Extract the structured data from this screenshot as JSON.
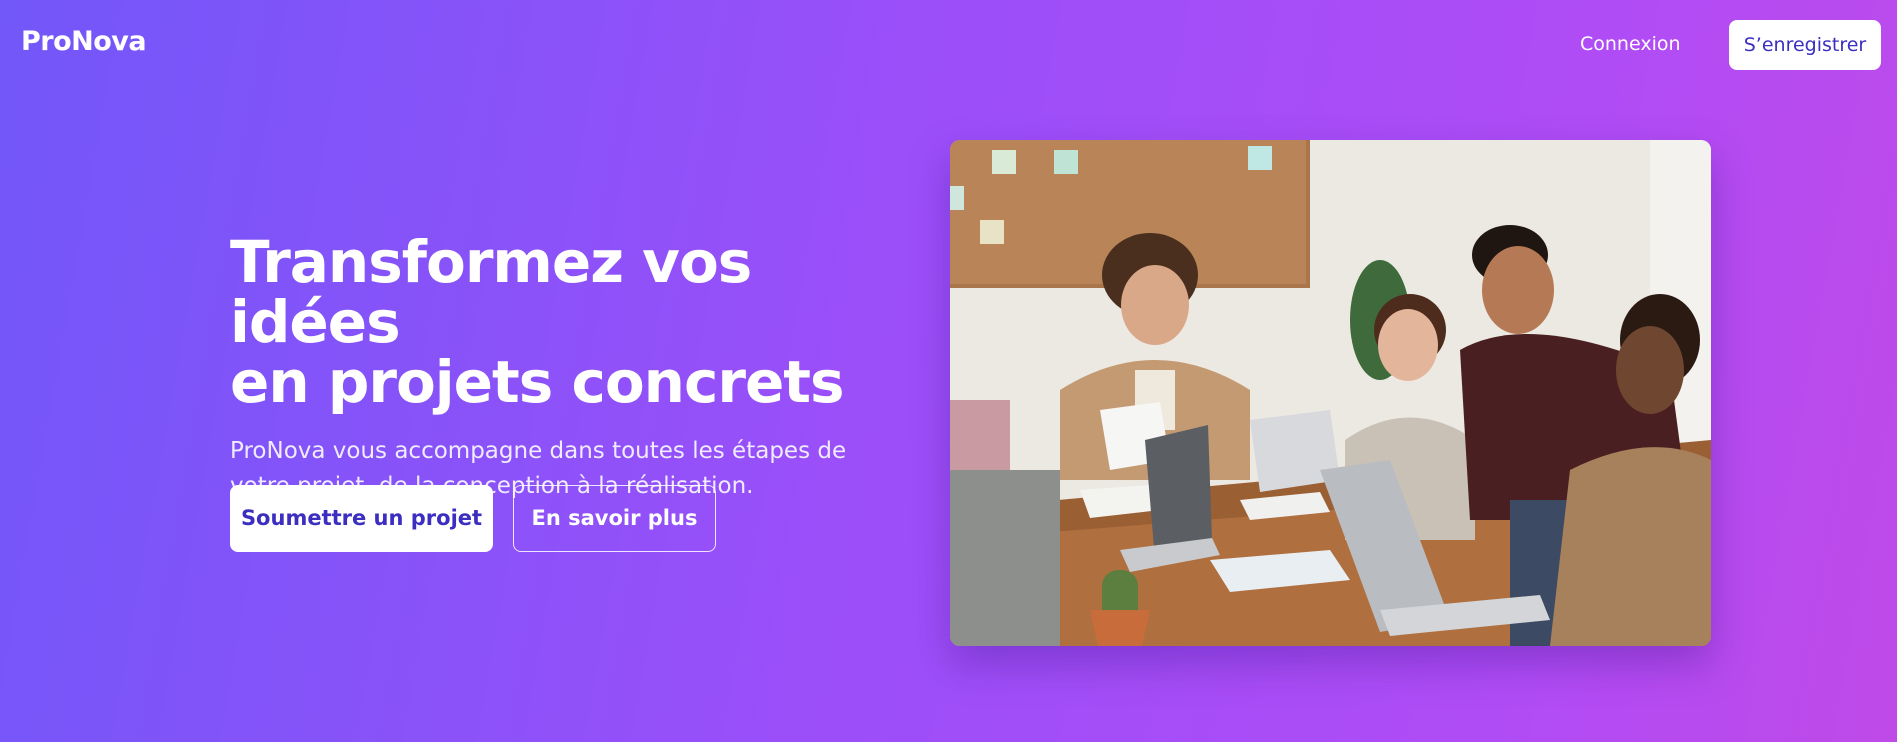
{
  "header": {
    "logo": "ProNova",
    "login_label": "Connexion",
    "register_label": "S’enregistrer"
  },
  "hero": {
    "title_line1": "Transformez vos idées",
    "title_line2": "en projets concrets",
    "subtitle": "ProNova vous accompagne dans toutes les étapes de votre projet, de la conception à la réalisation.",
    "primary_button": "Soumettre un projet",
    "secondary_button": "En savoir plus"
  },
  "colors": {
    "gradient_start": "#7257f9",
    "gradient_end": "#bf4ae8",
    "button_text": "#3b2ec0"
  }
}
